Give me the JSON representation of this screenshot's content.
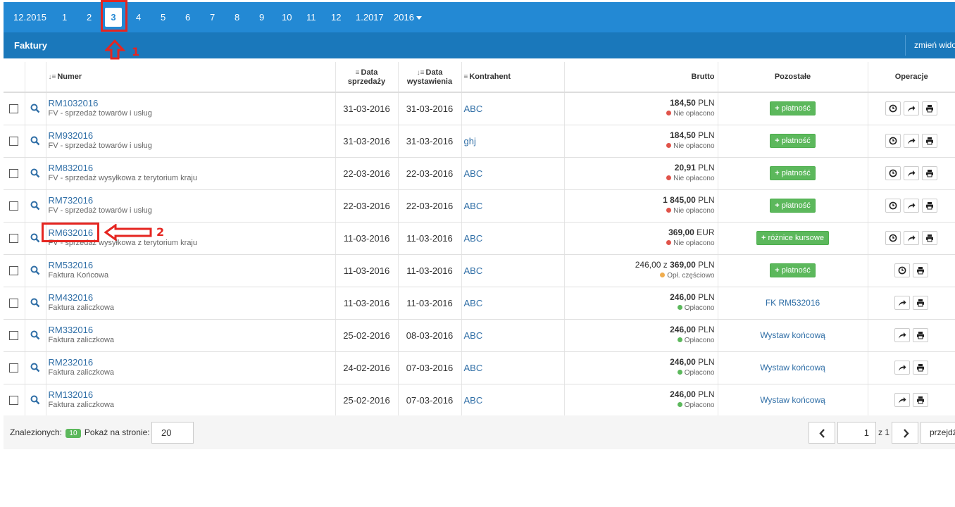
{
  "months": {
    "items": [
      "12.2015",
      "1",
      "2",
      "3",
      "4",
      "5",
      "6",
      "7",
      "8",
      "9",
      "10",
      "11",
      "12",
      "1.2017"
    ],
    "active": "3",
    "year": "2016"
  },
  "header": {
    "title": "Faktury",
    "change_view": "zmień widok"
  },
  "table": {
    "columns": {
      "numer": "Numer",
      "data_sprzedazy_1": "Data",
      "data_sprzedazy_2": "sprzedaży",
      "data_wystawienia_1": "Data",
      "data_wystawienia_2": "wystawienia",
      "kontrahent": "Kontrahent",
      "brutto": "Brutto",
      "pozostale": "Pozostałe",
      "operacje": "Operacje"
    },
    "rows": [
      {
        "number": "RM1032016",
        "type": "FV - sprzedaż towarów i usług",
        "sale_date": "31-03-2016",
        "issue_date": "31-03-2016",
        "contractor": "ABC",
        "amount_prefix": "",
        "amount": "184,50",
        "currency": "PLN",
        "status": "Nie opłacono",
        "action": "płatność"
      },
      {
        "number": "RM932016",
        "type": "FV - sprzedaż towarów i usług",
        "sale_date": "31-03-2016",
        "issue_date": "31-03-2016",
        "contractor": "ghj",
        "amount_prefix": "",
        "amount": "184,50",
        "currency": "PLN",
        "status": "Nie opłacono",
        "action": "płatność"
      },
      {
        "number": "RM832016",
        "type": "FV - sprzedaż wysyłkowa z terytorium kraju",
        "sale_date": "22-03-2016",
        "issue_date": "22-03-2016",
        "contractor": "ABC",
        "amount_prefix": "",
        "amount": "20,91",
        "currency": "PLN",
        "status": "Nie opłacono",
        "action": "płatność"
      },
      {
        "number": "RM732016",
        "type": "FV - sprzedaż towarów i usług",
        "sale_date": "22-03-2016",
        "issue_date": "22-03-2016",
        "contractor": "ABC",
        "amount_prefix": "",
        "amount": "1 845,00",
        "currency": "PLN",
        "status": "Nie opłacono",
        "action": "płatność"
      },
      {
        "number": "RM632016",
        "type": "FV - sprzedaż wysyłkowa z terytorium kraju",
        "sale_date": "11-03-2016",
        "issue_date": "11-03-2016",
        "contractor": "ABC",
        "amount_prefix": "",
        "amount": "369,00",
        "currency": "EUR",
        "status": "Nie opłacono",
        "action": "różnice kursowe"
      },
      {
        "number": "RM532016",
        "type": "Faktura Końcowa",
        "sale_date": "11-03-2016",
        "issue_date": "11-03-2016",
        "contractor": "ABC",
        "amount_prefix": "246,00 z",
        "amount": "369,00",
        "currency": "PLN",
        "status": "Opł. częściowo",
        "action": "płatność"
      },
      {
        "number": "RM432016",
        "type": "Faktura zaliczkowa",
        "sale_date": "11-03-2016",
        "issue_date": "11-03-2016",
        "contractor": "ABC",
        "amount_prefix": "",
        "amount": "246,00",
        "currency": "PLN",
        "status": "Opłacono",
        "link": "FK RM532016"
      },
      {
        "number": "RM332016",
        "type": "Faktura zaliczkowa",
        "sale_date": "25-02-2016",
        "issue_date": "08-03-2016",
        "contractor": "ABC",
        "amount_prefix": "",
        "amount": "246,00",
        "currency": "PLN",
        "status": "Opłacono",
        "link": "Wystaw końcową"
      },
      {
        "number": "RM232016",
        "type": "Faktura zaliczkowa",
        "sale_date": "24-02-2016",
        "issue_date": "07-03-2016",
        "contractor": "ABC",
        "amount_prefix": "",
        "amount": "246,00",
        "currency": "PLN",
        "status": "Opłacono",
        "link": "Wystaw końcową"
      },
      {
        "number": "RM132016",
        "type": "Faktura zaliczkowa",
        "sale_date": "25-02-2016",
        "issue_date": "07-03-2016",
        "contractor": "ABC",
        "amount_prefix": "",
        "amount": "246,00",
        "currency": "PLN",
        "status": "Opłacono",
        "link": "Wystaw końcową"
      }
    ]
  },
  "footer": {
    "found_label": "Znalezionych:",
    "found_count": "10",
    "per_page_label": "Pokaż na stronie:",
    "per_page_value": "20",
    "page_current": "1",
    "page_of": "z 1",
    "go_label": "przejdź"
  },
  "annotations": {
    "label_1": "1",
    "label_2": "2"
  },
  "colors": {
    "top_bar": "#2389d4",
    "title_bar": "#1a78bb",
    "link": "#2f6ea6",
    "green": "#5cb85c",
    "status_unpaid": "#e0534a",
    "status_partial": "#f0ad4e",
    "status_paid": "#5cb85c",
    "annotation": "#e52520"
  }
}
